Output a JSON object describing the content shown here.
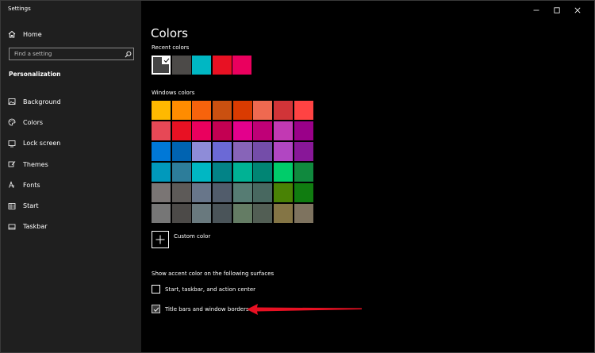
{
  "window": {
    "title": "Settings"
  },
  "sidebar": {
    "home": {
      "label": "Home",
      "icon": "home-icon"
    },
    "search": {
      "placeholder": "Find a setting",
      "icon": "search-icon"
    },
    "section_title": "Personalization",
    "items": [
      {
        "label": "Background",
        "icon": "image-icon"
      },
      {
        "label": "Colors",
        "icon": "palette-icon"
      },
      {
        "label": "Lock screen",
        "icon": "lock-screen-icon"
      },
      {
        "label": "Themes",
        "icon": "brush-icon"
      },
      {
        "label": "Fonts",
        "icon": "font-icon"
      },
      {
        "label": "Start",
        "icon": "start-icon"
      },
      {
        "label": "Taskbar",
        "icon": "taskbar-icon"
      }
    ]
  },
  "main": {
    "title": "Colors",
    "recent_label": "Recent colors",
    "recent_colors": [
      "#454545",
      "#4c4a48",
      "#00b7c3",
      "#e81123",
      "#ea005e"
    ],
    "recent_selected_index": 0,
    "windows_label": "Windows colors",
    "windows_colors": [
      "#ffb900",
      "#ff8c00",
      "#f7630c",
      "#ca5010",
      "#da3b01",
      "#ef6950",
      "#d13438",
      "#ff4343",
      "#e74856",
      "#e81123",
      "#ea005e",
      "#c30052",
      "#e3008c",
      "#bf0077",
      "#c239b3",
      "#9a0089",
      "#0078d7",
      "#0063b1",
      "#8e8cd8",
      "#6b69d6",
      "#8764b8",
      "#744da9",
      "#b146c2",
      "#881798",
      "#0099bc",
      "#2d7d9a",
      "#00b7c3",
      "#038387",
      "#00b294",
      "#018574",
      "#00cc6a",
      "#10893e",
      "#7a7574",
      "#5d5a58",
      "#68768a",
      "#515c6b",
      "#567c73",
      "#486860",
      "#498205",
      "#107c10",
      "#767676",
      "#4c4a48",
      "#69797e",
      "#4a5459",
      "#647c64",
      "#525e54",
      "#847545",
      "#7e735f"
    ],
    "custom_color_label": "Custom color",
    "surfaces_label": "Show accent color on the following surfaces",
    "surfaces": [
      {
        "label": "Start, taskbar, and action center",
        "checked": false
      },
      {
        "label": "Title bars and window borders",
        "checked": true
      }
    ]
  },
  "annotation": {
    "arrow_color": "#e81123"
  }
}
